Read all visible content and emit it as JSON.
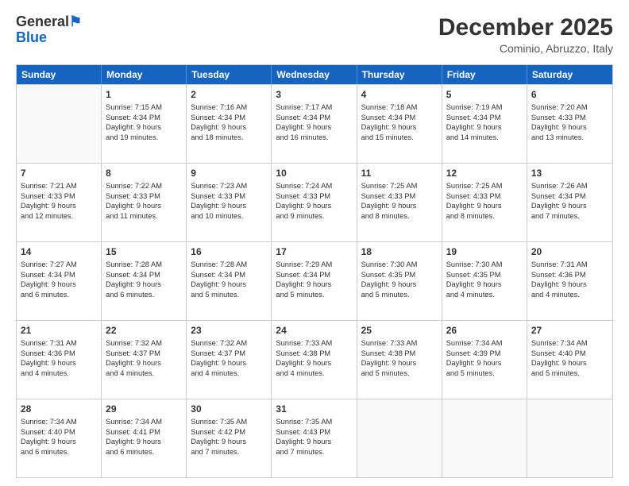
{
  "logo": {
    "line1": "General",
    "line2": "Blue"
  },
  "header": {
    "month": "December 2025",
    "location": "Cominio, Abruzzo, Italy"
  },
  "weekdays": [
    "Sunday",
    "Monday",
    "Tuesday",
    "Wednesday",
    "Thursday",
    "Friday",
    "Saturday"
  ],
  "weeks": [
    [
      {
        "day": "",
        "lines": []
      },
      {
        "day": "1",
        "lines": [
          "Sunrise: 7:15 AM",
          "Sunset: 4:34 PM",
          "Daylight: 9 hours",
          "and 19 minutes."
        ]
      },
      {
        "day": "2",
        "lines": [
          "Sunrise: 7:16 AM",
          "Sunset: 4:34 PM",
          "Daylight: 9 hours",
          "and 18 minutes."
        ]
      },
      {
        "day": "3",
        "lines": [
          "Sunrise: 7:17 AM",
          "Sunset: 4:34 PM",
          "Daylight: 9 hours",
          "and 16 minutes."
        ]
      },
      {
        "day": "4",
        "lines": [
          "Sunrise: 7:18 AM",
          "Sunset: 4:34 PM",
          "Daylight: 9 hours",
          "and 15 minutes."
        ]
      },
      {
        "day": "5",
        "lines": [
          "Sunrise: 7:19 AM",
          "Sunset: 4:34 PM",
          "Daylight: 9 hours",
          "and 14 minutes."
        ]
      },
      {
        "day": "6",
        "lines": [
          "Sunrise: 7:20 AM",
          "Sunset: 4:33 PM",
          "Daylight: 9 hours",
          "and 13 minutes."
        ]
      }
    ],
    [
      {
        "day": "7",
        "lines": [
          "Sunrise: 7:21 AM",
          "Sunset: 4:33 PM",
          "Daylight: 9 hours",
          "and 12 minutes."
        ]
      },
      {
        "day": "8",
        "lines": [
          "Sunrise: 7:22 AM",
          "Sunset: 4:33 PM",
          "Daylight: 9 hours",
          "and 11 minutes."
        ]
      },
      {
        "day": "9",
        "lines": [
          "Sunrise: 7:23 AM",
          "Sunset: 4:33 PM",
          "Daylight: 9 hours",
          "and 10 minutes."
        ]
      },
      {
        "day": "10",
        "lines": [
          "Sunrise: 7:24 AM",
          "Sunset: 4:33 PM",
          "Daylight: 9 hours",
          "and 9 minutes."
        ]
      },
      {
        "day": "11",
        "lines": [
          "Sunrise: 7:25 AM",
          "Sunset: 4:33 PM",
          "Daylight: 9 hours",
          "and 8 minutes."
        ]
      },
      {
        "day": "12",
        "lines": [
          "Sunrise: 7:25 AM",
          "Sunset: 4:33 PM",
          "Daylight: 9 hours",
          "and 8 minutes."
        ]
      },
      {
        "day": "13",
        "lines": [
          "Sunrise: 7:26 AM",
          "Sunset: 4:34 PM",
          "Daylight: 9 hours",
          "and 7 minutes."
        ]
      }
    ],
    [
      {
        "day": "14",
        "lines": [
          "Sunrise: 7:27 AM",
          "Sunset: 4:34 PM",
          "Daylight: 9 hours",
          "and 6 minutes."
        ]
      },
      {
        "day": "15",
        "lines": [
          "Sunrise: 7:28 AM",
          "Sunset: 4:34 PM",
          "Daylight: 9 hours",
          "and 6 minutes."
        ]
      },
      {
        "day": "16",
        "lines": [
          "Sunrise: 7:28 AM",
          "Sunset: 4:34 PM",
          "Daylight: 9 hours",
          "and 5 minutes."
        ]
      },
      {
        "day": "17",
        "lines": [
          "Sunrise: 7:29 AM",
          "Sunset: 4:34 PM",
          "Daylight: 9 hours",
          "and 5 minutes."
        ]
      },
      {
        "day": "18",
        "lines": [
          "Sunrise: 7:30 AM",
          "Sunset: 4:35 PM",
          "Daylight: 9 hours",
          "and 5 minutes."
        ]
      },
      {
        "day": "19",
        "lines": [
          "Sunrise: 7:30 AM",
          "Sunset: 4:35 PM",
          "Daylight: 9 hours",
          "and 4 minutes."
        ]
      },
      {
        "day": "20",
        "lines": [
          "Sunrise: 7:31 AM",
          "Sunset: 4:36 PM",
          "Daylight: 9 hours",
          "and 4 minutes."
        ]
      }
    ],
    [
      {
        "day": "21",
        "lines": [
          "Sunrise: 7:31 AM",
          "Sunset: 4:36 PM",
          "Daylight: 9 hours",
          "and 4 minutes."
        ]
      },
      {
        "day": "22",
        "lines": [
          "Sunrise: 7:32 AM",
          "Sunset: 4:37 PM",
          "Daylight: 9 hours",
          "and 4 minutes."
        ]
      },
      {
        "day": "23",
        "lines": [
          "Sunrise: 7:32 AM",
          "Sunset: 4:37 PM",
          "Daylight: 9 hours",
          "and 4 minutes."
        ]
      },
      {
        "day": "24",
        "lines": [
          "Sunrise: 7:33 AM",
          "Sunset: 4:38 PM",
          "Daylight: 9 hours",
          "and 4 minutes."
        ]
      },
      {
        "day": "25",
        "lines": [
          "Sunrise: 7:33 AM",
          "Sunset: 4:38 PM",
          "Daylight: 9 hours",
          "and 5 minutes."
        ]
      },
      {
        "day": "26",
        "lines": [
          "Sunrise: 7:34 AM",
          "Sunset: 4:39 PM",
          "Daylight: 9 hours",
          "and 5 minutes."
        ]
      },
      {
        "day": "27",
        "lines": [
          "Sunrise: 7:34 AM",
          "Sunset: 4:40 PM",
          "Daylight: 9 hours",
          "and 5 minutes."
        ]
      }
    ],
    [
      {
        "day": "28",
        "lines": [
          "Sunrise: 7:34 AM",
          "Sunset: 4:40 PM",
          "Daylight: 9 hours",
          "and 6 minutes."
        ]
      },
      {
        "day": "29",
        "lines": [
          "Sunrise: 7:34 AM",
          "Sunset: 4:41 PM",
          "Daylight: 9 hours",
          "and 6 minutes."
        ]
      },
      {
        "day": "30",
        "lines": [
          "Sunrise: 7:35 AM",
          "Sunset: 4:42 PM",
          "Daylight: 9 hours",
          "and 7 minutes."
        ]
      },
      {
        "day": "31",
        "lines": [
          "Sunrise: 7:35 AM",
          "Sunset: 4:43 PM",
          "Daylight: 9 hours",
          "and 7 minutes."
        ]
      },
      {
        "day": "",
        "lines": []
      },
      {
        "day": "",
        "lines": []
      },
      {
        "day": "",
        "lines": []
      }
    ]
  ]
}
